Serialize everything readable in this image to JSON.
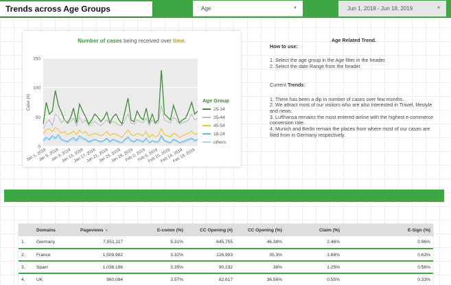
{
  "header": {
    "title": "Trends across Age Groups",
    "age_filter": {
      "value": "Age"
    },
    "date_filter": {
      "value": "Jun 1, 2018 - Jun 18, 2019"
    },
    "colors": {
      "accent": "#3ea744"
    }
  },
  "chart_title": {
    "part1": "Number of cases",
    "part2": " being received over ",
    "part3": "time",
    "part4": "."
  },
  "chart_data": {
    "type": "line",
    "title": "Number of cases being received over time.",
    "ylabel": "Case (#)",
    "xlabel": "",
    "ylim": [
      0,
      150
    ],
    "yticks": [
      0,
      50,
      100,
      150
    ],
    "xtick_labels": [
      "Jan 1, 2019",
      "Jan 5, 2019",
      "Jan 9, 2019",
      "Jan 13, 2019",
      "Jan 17, 2019",
      "Jan 21, 2019",
      "Jan 25, 2019",
      "Jan 29, 2019",
      "Feb 2, 2019",
      "Feb 6, 2019",
      "Feb 10, 2019",
      "Feb 14, 2019",
      "Feb 18, 2019"
    ],
    "legend_title": "Age Group",
    "legend_position": "right",
    "grid": true,
    "x_range": [
      "Jan 1, 2019",
      "Feb 21, 2019"
    ],
    "series": [
      {
        "name": "25-34",
        "color": "#3d8b37",
        "values": [
          38,
          75,
          55,
          60,
          95,
          70,
          58,
          45,
          40,
          48,
          65,
          40,
          72,
          60,
          50,
          38,
          45,
          55,
          50,
          42,
          48,
          58,
          40,
          50,
          55,
          45,
          38,
          60,
          82,
          45,
          42,
          60,
          50,
          45,
          65,
          40,
          55,
          40,
          45,
          130,
          55,
          50,
          45,
          70,
          55,
          40,
          45,
          48,
          60,
          75,
          55,
          60
        ]
      },
      {
        "name": "35-44",
        "color": "#bdbdbd",
        "values": [
          30,
          40,
          45,
          35,
          55,
          50,
          40,
          45,
          38,
          42,
          48,
          35,
          50,
          40,
          45,
          35,
          40,
          42,
          38,
          35,
          40,
          45,
          38,
          42,
          40,
          36,
          35,
          45,
          55,
          40,
          38,
          45,
          42,
          40,
          48,
          36,
          45,
          38,
          40,
          70,
          45,
          42,
          40,
          50,
          45,
          38,
          40,
          42,
          45,
          55,
          45,
          48
        ]
      },
      {
        "name": "45-54",
        "color": "#f6c030",
        "values": [
          22,
          28,
          30,
          25,
          32,
          28,
          22,
          25,
          20,
          22,
          26,
          20,
          28,
          22,
          25,
          18,
          20,
          22,
          20,
          18,
          20,
          25,
          18,
          22,
          20,
          18,
          15,
          22,
          28,
          20,
          18,
          22,
          20,
          18,
          25,
          15,
          20,
          16,
          18,
          30,
          20,
          18,
          16,
          22,
          20,
          15,
          18,
          20,
          22,
          26,
          20,
          22
        ]
      },
      {
        "name": "18-24",
        "color": "#5db8e6",
        "values": [
          10,
          15,
          12,
          18,
          14,
          20,
          12,
          10,
          8,
          12,
          15,
          10,
          18,
          14,
          12,
          8,
          10,
          12,
          10,
          8,
          10,
          14,
          8,
          12,
          10,
          8,
          6,
          12,
          16,
          10,
          8,
          12,
          10,
          8,
          14,
          6,
          10,
          8,
          8,
          18,
          10,
          8,
          6,
          12,
          10,
          6,
          8,
          10,
          12,
          14,
          10,
          12
        ]
      },
      {
        "name": "others",
        "color": "#a6d8f2",
        "values": [
          8,
          12,
          10,
          15,
          12,
          16,
          10,
          8,
          6,
          10,
          12,
          8,
          14,
          12,
          10,
          6,
          8,
          10,
          8,
          6,
          8,
          12,
          6,
          10,
          8,
          6,
          5,
          10,
          14,
          8,
          6,
          10,
          8,
          6,
          12,
          5,
          8,
          6,
          6,
          15,
          8,
          6,
          5,
          10,
          8,
          5,
          6,
          8,
          10,
          12,
          8,
          10
        ]
      }
    ]
  },
  "info_panel": {
    "heading": "Age Related Trend.",
    "how_to_use_label": "How to use:",
    "how_to_use_items": [
      "1. Select the age group in the Age filter in the header.",
      "2. Select the date Range from the header."
    ],
    "current_trends_prefix": "Current ",
    "current_trends_bold": "Trends",
    "current_trends_suffix": ":",
    "trend_items": [
      "1. There has been a dip in number of cases over few months.",
      "2. We attract most of our visitors who are also interested in Travel, lifestyle and news.",
      "3. Lufthansa remains the most entered airline with the highest e-commerce conversion rate.",
      "4. Munich and Berlin remain the places from where most of our cases are filed from in Germany respectively."
    ]
  },
  "table": {
    "columns": [
      "Domains",
      "Pageviews",
      "E-comm (%)",
      "CC Opening (#)",
      "CC Opening (%)",
      "Claim (%)",
      "E-Sign (%)"
    ],
    "sort_arrow": "▼",
    "rows": [
      {
        "index": "1.",
        "domain": "Germany",
        "pageviews": "7,551,117",
        "ecomm": "5.31%",
        "cc_open_n": "645,755",
        "cc_open_pct": "46.38%",
        "claim": "2.46%",
        "esign": "0.96%"
      },
      {
        "index": "2.",
        "domain": "France",
        "pageviews": "1,509,982",
        "ecomm": "3.32%",
        "cc_open_n": "126,993",
        "cc_open_pct": "35.3%",
        "claim": "1.68%",
        "esign": "0.63%"
      },
      {
        "index": "3.",
        "domain": "Spain",
        "pageviews": "1,038,196",
        "ecomm": "3.35%",
        "cc_open_n": "90,132",
        "cc_open_pct": "38%",
        "claim": "1.25%",
        "esign": "0.56%"
      },
      {
        "index": "4.",
        "domain": "UK",
        "pageviews": "960,084",
        "ecomm": "3.57%",
        "cc_open_n": "82,617",
        "cc_open_pct": "36.56%",
        "claim": "0.55%",
        "esign": "0.33%"
      }
    ]
  }
}
